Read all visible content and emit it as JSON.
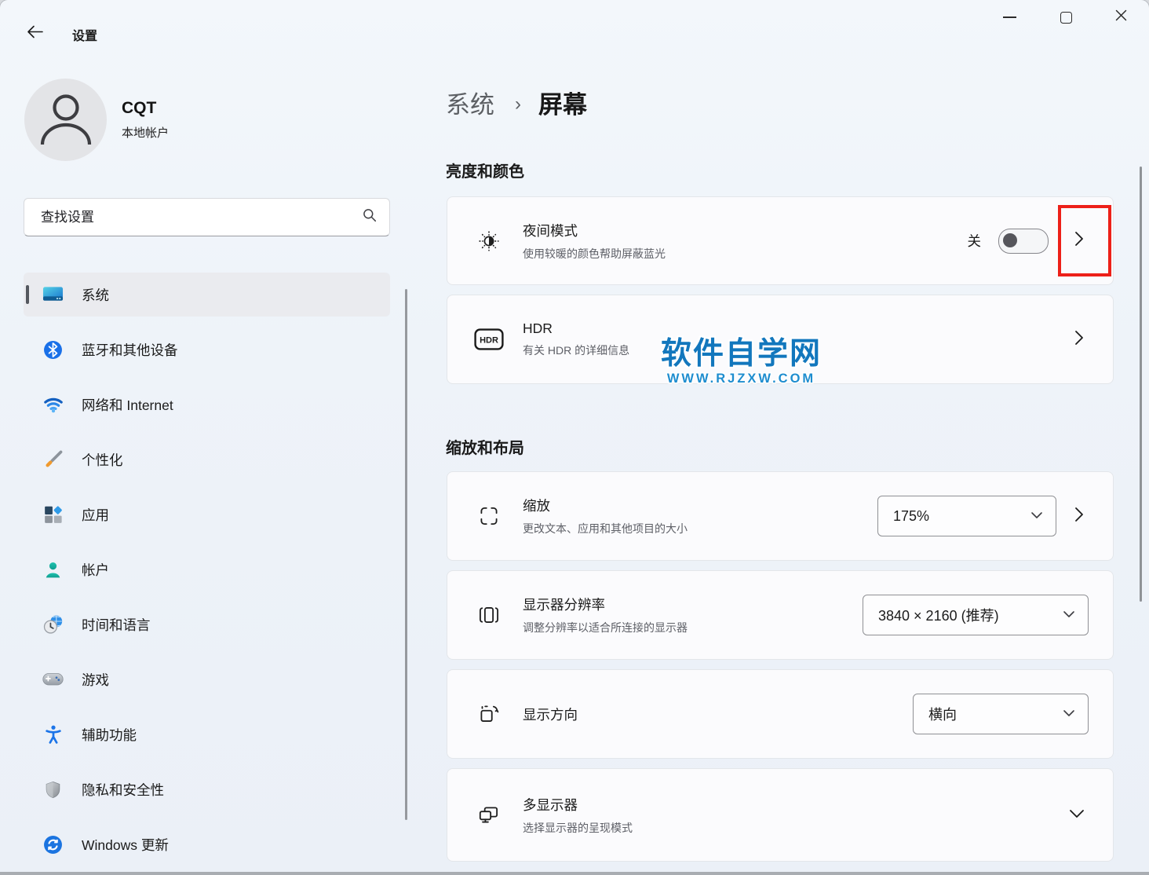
{
  "titlebar": {
    "title": "设置"
  },
  "window_controls": {
    "minimize": "minimize",
    "maximize": "maximize",
    "close": "close"
  },
  "user": {
    "name": "CQT",
    "account_type": "本地帐户"
  },
  "search": {
    "placeholder": "查找设置"
  },
  "sidebar": {
    "items": [
      {
        "label": "系统",
        "icon": "system-icon",
        "selected": true
      },
      {
        "label": "蓝牙和其他设备",
        "icon": "bluetooth-icon",
        "selected": false
      },
      {
        "label": "网络和 Internet",
        "icon": "network-icon",
        "selected": false
      },
      {
        "label": "个性化",
        "icon": "personalization-icon",
        "selected": false
      },
      {
        "label": "应用",
        "icon": "apps-icon",
        "selected": false
      },
      {
        "label": "帐户",
        "icon": "accounts-icon",
        "selected": false
      },
      {
        "label": "时间和语言",
        "icon": "time-language-icon",
        "selected": false
      },
      {
        "label": "游戏",
        "icon": "gaming-icon",
        "selected": false
      },
      {
        "label": "辅助功能",
        "icon": "accessibility-icon",
        "selected": false
      },
      {
        "label": "隐私和安全性",
        "icon": "privacy-icon",
        "selected": false
      },
      {
        "label": "Windows 更新",
        "icon": "windows-update-icon",
        "selected": false
      }
    ]
  },
  "breadcrumb": {
    "parent": "系统",
    "separator": "›",
    "current": "屏幕"
  },
  "sections": {
    "brightness": {
      "heading": "亮度和颜色"
    },
    "layout": {
      "heading": "缩放和布局"
    }
  },
  "cards": {
    "night_light": {
      "title": "夜间模式",
      "subtitle": "使用较暖的颜色帮助屏蔽蓝光",
      "toggle_label": "关",
      "toggle_state": "off"
    },
    "hdr": {
      "title": "HDR",
      "subtitle": "有关 HDR 的详细信息",
      "badge": "HDR"
    },
    "scale": {
      "title": "缩放",
      "subtitle": "更改文本、应用和其他项目的大小",
      "value": "175%"
    },
    "resolution": {
      "title": "显示器分辨率",
      "subtitle": "调整分辨率以适合所连接的显示器",
      "value": "3840 × 2160 (推荐)"
    },
    "orientation": {
      "title": "显示方向",
      "value": "横向"
    },
    "multi_display": {
      "title": "多显示器",
      "subtitle": "选择显示器的呈现模式"
    }
  },
  "watermark": {
    "title": "软件自学网",
    "url": "WWW.RJZXW.COM"
  },
  "annotations": {
    "highlight_color": "#ed2019",
    "highlight_target": "night-light-chevron"
  },
  "icons": {
    "back": "←",
    "search": "🔍",
    "chevron_right": "›",
    "chevron_down": "⌄",
    "minimize": "—",
    "maximize": "□",
    "close": "✕"
  },
  "colors": {
    "watermark_blue": "#1277bd",
    "selected_indicator": "#54585f",
    "card_bg": "#fbfbfd",
    "window_bg": "#eef3f9"
  }
}
